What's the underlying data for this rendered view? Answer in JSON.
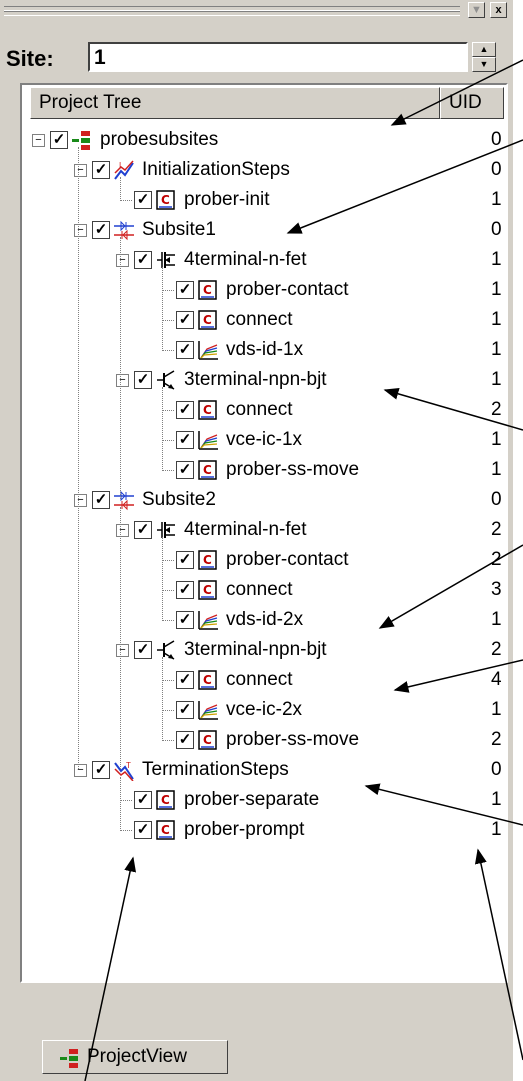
{
  "window": {
    "close_label": "x",
    "dropdown_label": "▼"
  },
  "site": {
    "label": "Site:",
    "value": "1"
  },
  "tree": {
    "col_name": "Project Tree",
    "col_uid": "UID",
    "rows": [
      {
        "label": "probesubsites",
        "uid": "0",
        "icon": "project-icon"
      },
      {
        "label": "InitializationSteps",
        "uid": "0",
        "icon": "init-steps-icon"
      },
      {
        "label": "prober-init",
        "uid": "1",
        "icon": "script-icon"
      },
      {
        "label": "Subsite1",
        "uid": "0",
        "icon": "subsite-icon"
      },
      {
        "label": "4terminal-n-fet",
        "uid": "1",
        "icon": "fet-device-icon"
      },
      {
        "label": "prober-contact",
        "uid": "1",
        "icon": "script-icon"
      },
      {
        "label": "connect",
        "uid": "1",
        "icon": "script-icon"
      },
      {
        "label": "vds-id-1x",
        "uid": "1",
        "icon": "test-graph-icon"
      },
      {
        "label": "3terminal-npn-bjt",
        "uid": "1",
        "icon": "bjt-device-icon"
      },
      {
        "label": "connect",
        "uid": "2",
        "icon": "script-icon"
      },
      {
        "label": "vce-ic-1x",
        "uid": "1",
        "icon": "test-graph-icon"
      },
      {
        "label": "prober-ss-move",
        "uid": "1",
        "icon": "script-icon"
      },
      {
        "label": "Subsite2",
        "uid": "0",
        "icon": "subsite-icon"
      },
      {
        "label": "4terminal-n-fet",
        "uid": "2",
        "icon": "fet-device-icon"
      },
      {
        "label": "prober-contact",
        "uid": "2",
        "icon": "script-icon"
      },
      {
        "label": "connect",
        "uid": "3",
        "icon": "script-icon"
      },
      {
        "label": "vds-id-2x",
        "uid": "1",
        "icon": "test-graph-icon"
      },
      {
        "label": "3terminal-npn-bjt",
        "uid": "2",
        "icon": "bjt-device-icon"
      },
      {
        "label": "connect",
        "uid": "4",
        "icon": "script-icon"
      },
      {
        "label": "vce-ic-2x",
        "uid": "1",
        "icon": "test-graph-icon"
      },
      {
        "label": "prober-ss-move",
        "uid": "2",
        "icon": "script-icon"
      },
      {
        "label": "TerminationSteps",
        "uid": "0",
        "icon": "term-steps-icon"
      },
      {
        "label": "prober-separate",
        "uid": "1",
        "icon": "script-icon"
      },
      {
        "label": "prober-prompt",
        "uid": "1",
        "icon": "script-icon"
      }
    ]
  },
  "tabs": {
    "project_view": "ProjectView"
  }
}
